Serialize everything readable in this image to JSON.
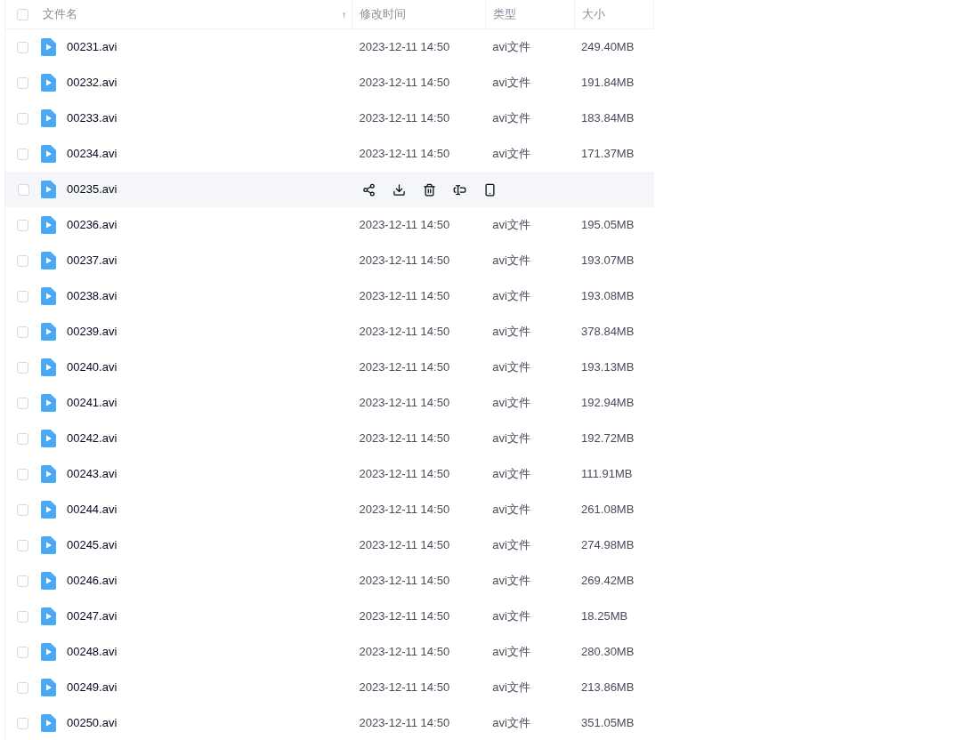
{
  "header": {
    "checked": false,
    "columns": [
      {
        "label": "文件名",
        "sort_icon": "↑"
      },
      {
        "label": "修改时间"
      },
      {
        "label": "类型"
      },
      {
        "label": "大小"
      }
    ]
  },
  "rows": [
    {
      "name": "00231.avi",
      "modified": "2023-12-11 14:50",
      "type": "avi文件",
      "size": "249.40MB",
      "checked": false,
      "hovered": false
    },
    {
      "name": "00232.avi",
      "modified": "2023-12-11 14:50",
      "type": "avi文件",
      "size": "191.84MB",
      "checked": false,
      "hovered": false
    },
    {
      "name": "00233.avi",
      "modified": "2023-12-11 14:50",
      "type": "avi文件",
      "size": "183.84MB",
      "checked": false,
      "hovered": false
    },
    {
      "name": "00234.avi",
      "modified": "2023-12-11 14:50",
      "type": "avi文件",
      "size": "171.37MB",
      "checked": false,
      "hovered": false
    },
    {
      "name": "00235.avi",
      "checked": false,
      "hovered": true
    },
    {
      "name": "00236.avi",
      "modified": "2023-12-11 14:50",
      "type": "avi文件",
      "size": "195.05MB",
      "checked": false,
      "hovered": false
    },
    {
      "name": "00237.avi",
      "modified": "2023-12-11 14:50",
      "type": "avi文件",
      "size": "193.07MB",
      "checked": false,
      "hovered": false
    },
    {
      "name": "00238.avi",
      "modified": "2023-12-11 14:50",
      "type": "avi文件",
      "size": "193.08MB",
      "checked": false,
      "hovered": false
    },
    {
      "name": "00239.avi",
      "modified": "2023-12-11 14:50",
      "type": "avi文件",
      "size": "378.84MB",
      "checked": false,
      "hovered": false
    },
    {
      "name": "00240.avi",
      "modified": "2023-12-11 14:50",
      "type": "avi文件",
      "size": "193.13MB",
      "checked": false,
      "hovered": false
    },
    {
      "name": "00241.avi",
      "modified": "2023-12-11 14:50",
      "type": "avi文件",
      "size": "192.94MB",
      "checked": false,
      "hovered": false
    },
    {
      "name": "00242.avi",
      "modified": "2023-12-11 14:50",
      "type": "avi文件",
      "size": "192.72MB",
      "checked": false,
      "hovered": false
    },
    {
      "name": "00243.avi",
      "modified": "2023-12-11 14:50",
      "type": "avi文件",
      "size": "111.91MB",
      "checked": false,
      "hovered": false
    },
    {
      "name": "00244.avi",
      "modified": "2023-12-11 14:50",
      "type": "avi文件",
      "size": "261.08MB",
      "checked": false,
      "hovered": false
    },
    {
      "name": "00245.avi",
      "modified": "2023-12-11 14:50",
      "type": "avi文件",
      "size": "274.98MB",
      "checked": false,
      "hovered": false
    },
    {
      "name": "00246.avi",
      "modified": "2023-12-11 14:50",
      "type": "avi文件",
      "size": "269.42MB",
      "checked": false,
      "hovered": false
    },
    {
      "name": "00247.avi",
      "modified": "2023-12-11 14:50",
      "type": "avi文件",
      "size": "18.25MB",
      "checked": false,
      "hovered": false
    },
    {
      "name": "00248.avi",
      "modified": "2023-12-11 14:50",
      "type": "avi文件",
      "size": "280.30MB",
      "checked": false,
      "hovered": false
    },
    {
      "name": "00249.avi",
      "modified": "2023-12-11 14:50",
      "type": "avi文件",
      "size": "213.86MB",
      "checked": false,
      "hovered": false
    },
    {
      "name": "00250.avi",
      "modified": "2023-12-11 14:50",
      "type": "avi文件",
      "size": "351.05MB",
      "checked": false,
      "hovered": false
    }
  ]
}
